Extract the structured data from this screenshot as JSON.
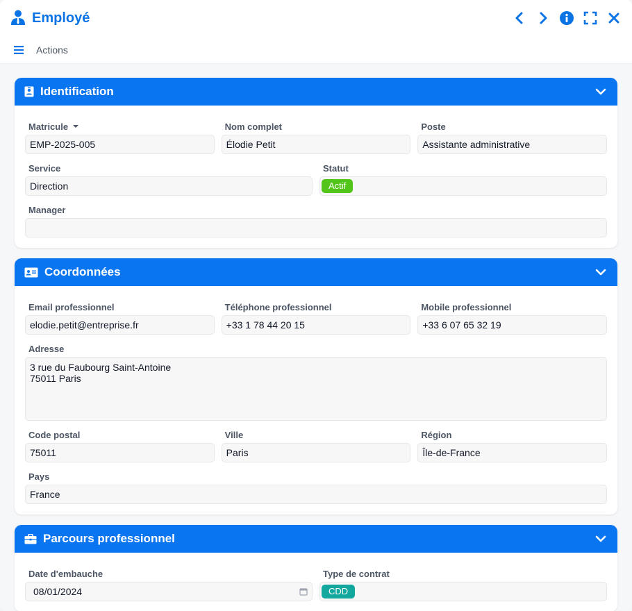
{
  "window": {
    "title": "Employé",
    "actions_label": "Actions"
  },
  "colors": {
    "accent": "#0a75f0",
    "active_badge": "#52c41a",
    "contract_badge": "#13a89e"
  },
  "identification": {
    "title": "Identification",
    "matricule": {
      "label": "Matricule",
      "value": "EMP-2025-005"
    },
    "nom": {
      "label": "Nom complet",
      "value": "Élodie Petit"
    },
    "poste": {
      "label": "Poste",
      "value": "Assistante administrative"
    },
    "service": {
      "label": "Service",
      "value": "Direction"
    },
    "statut": {
      "label": "Statut",
      "value": "Actif"
    },
    "manager": {
      "label": "Manager",
      "value": ""
    }
  },
  "coordonnees": {
    "title": "Coordonnées",
    "email": {
      "label": "Email professionnel",
      "value": "elodie.petit@entreprise.fr"
    },
    "tel": {
      "label": "Téléphone professionnel",
      "value": "+33 1 78 44 20 15"
    },
    "mobile": {
      "label": "Mobile professionnel",
      "value": "+33 6 07 65 32 19"
    },
    "adresse": {
      "label": "Adresse",
      "value": "3 rue du Faubourg Saint-Antoine\n75011 Paris"
    },
    "cp": {
      "label": "Code postal",
      "value": "75011"
    },
    "ville": {
      "label": "Ville",
      "value": "Paris"
    },
    "region": {
      "label": "Région",
      "value": "Île-de-France"
    },
    "pays": {
      "label": "Pays",
      "value": "France"
    }
  },
  "parcours": {
    "title": "Parcours professionnel",
    "embauche": {
      "label": "Date d'embauche",
      "value": "08/01/2024"
    },
    "contrat": {
      "label": "Type de contrat",
      "value": "CDD"
    }
  }
}
